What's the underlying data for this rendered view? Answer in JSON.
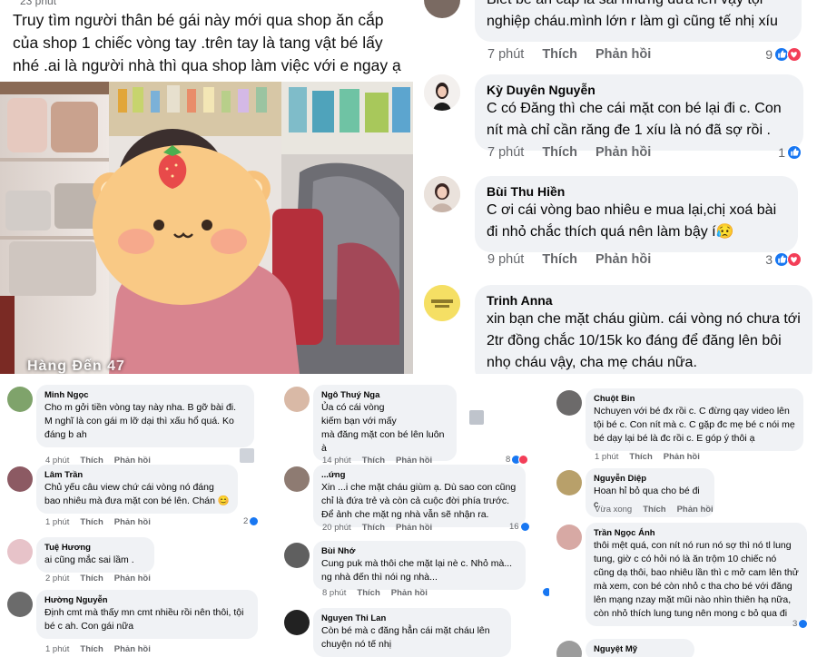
{
  "post": {
    "time": "23 phút",
    "text": "Truy tìm người thân bé gái này mới qua shop ăn cắp của shop 1 chiếc vòng tay .trên tay là tang vật bé lấy nhé .ai là người nhà thì qua shop làm việc với e ngay ạ",
    "photo_caption": "Hàng Đến 47"
  },
  "top_comments": [
    {
      "name": "",
      "text": "Biết bé ăn cắp là sai nhưng đưa lên vậy tội nghiệp cháu.mình lớn r làm gì cũng tế nhị xíu",
      "time": "7 phút",
      "like": "Thích",
      "reply": "Phản hồi",
      "count": "9",
      "reactions": [
        "like",
        "love"
      ]
    },
    {
      "name": "Kỳ Duyên Nguyễn",
      "text": "C có Đăng thì che cái mặt con bé lại đi c. Con nít mà chỉ cần răng đe 1 xíu là nó đã sợ rồi .",
      "time": "7 phút",
      "like": "Thích",
      "reply": "Phản hồi",
      "count": "1",
      "reactions": [
        "like"
      ]
    },
    {
      "name": "Bùi Thu Hiền",
      "text": "C ơi cái vòng bao nhiêu e mua lại,chị xoá bài đi nhỏ chắc thích quá nên làm bậy í😥",
      "time": "9 phút",
      "like": "Thích",
      "reply": "Phản hồi",
      "count": "3",
      "reactions": [
        "like",
        "love"
      ]
    },
    {
      "name": "Trinh Anna",
      "text": "xin  bạn che mặt cháu giùm. cái vòng nó chưa tới 2tr đồng chắc 10/15k ko đáng  để đăng lên bôi nhọ cháu vậy, cha mẹ cháu nữa.\ncon nít ko hiểu biết thích quá cầm thôi chứ gì",
      "time": "",
      "like": "",
      "reply": "",
      "count": "",
      "reactions": []
    }
  ],
  "col1": [
    {
      "name": "Minh Ngọc",
      "text": "Cho m gởi tiền vòng tay này nha. B gỡ bài đi. M nghĩ là con gái m lỡ dại thì xấu hổ quá. Ko đáng b ah",
      "time": "4 phút",
      "like": "Thích",
      "reply": "Phản hồi",
      "count": "",
      "reactions": []
    },
    {
      "name": "Lâm Trần",
      "text": "Chủ yếu câu view chứ cái vòng nó đáng bao nhiêu mà đưa mặt con bé lên. Chán 😊",
      "time": "1 phút",
      "like": "Thích",
      "reply": "Phản hồi",
      "count": "2",
      "reactions": [
        "like"
      ]
    },
    {
      "name": "Tuệ Hương",
      "text": "ai cũng mắc sai lầm .",
      "time": "2 phút",
      "like": "Thích",
      "reply": "Phản hồi",
      "count": "",
      "reactions": []
    },
    {
      "name": "Hường Nguyễn",
      "text": "Định cmt mà thấy mn cmt nhiều rồi nên thôi, tội bé c ah. Con gái nữa",
      "time": "1 phút",
      "like": "Thích",
      "reply": "Phản hồi",
      "count": "",
      "reactions": []
    }
  ],
  "col2": [
    {
      "name": "Ngô Thuý Nga",
      "text": "Ủa có cái vòng\nkiếm bạn với mấy\nmà đăng mặt con bé lên luôn à",
      "time": "14 phút",
      "like": "Thích",
      "reply": "Phản hồi",
      "count": "8",
      "reactions": [
        "like",
        "love"
      ]
    },
    {
      "name": "...ứng",
      "text": "Xin ...i che mặt cháu giùm ạ. Dù sao con cũng chỉ là đứa trẻ và còn cả cuộc đời phía trước. Để ảnh che mặt ng nhà vẫn sẽ nhận ra.",
      "time": "20 phút",
      "like": "Thích",
      "reply": "Phản hồi",
      "count": "16",
      "reactions": [
        "like"
      ]
    },
    {
      "name": "Bùi Nhớ",
      "text": "Cung puk mà thôi che mặt lại nè c. Nhỏ mà... ng nhà đến thì nói ng nhà...",
      "time": "8 phút",
      "like": "Thích",
      "reply": "Phản hồi",
      "count": "",
      "reactions": [
        "like"
      ]
    },
    {
      "name": "Nguyen Thi Lan",
      "text": "Còn bé mà c đăng hẳn cái mặt cháu lên chuyện nó tế nhị",
      "time": "",
      "like": "",
      "reply": "",
      "count": "",
      "reactions": []
    }
  ],
  "col3": [
    {
      "name": "Chuột Bin",
      "text": "Nchuyen với bé đx rồi c. C đừng qay video lên tội bé c. Con nít mà c. C gặp đc mẹ bé c nói mẹ bé dạy lại bé là đc rồi c. E góp ý thôi ạ",
      "time": "1 phút",
      "like": "Thích",
      "reply": "Phản hồi",
      "count": "",
      "reactions": []
    },
    {
      "name": "Nguyễn Diệp",
      "text": "Hoan hỉ bỏ qua cho bé đi c",
      "time": "Vừa xong",
      "like": "Thích",
      "reply": "Phản hồi",
      "count": "",
      "reactions": []
    },
    {
      "name": "Trần Ngọc Ánh",
      "text": "thôi mệt quá, con nít nó run nó sợ thì nó tl lung tung, giờ c có hỏi nó là ăn trộm 10 chiếc nó cũng dạ thôi, bao nhiêu lần thì c mở cam lên thử mà xem, con bé còn nhỏ c tha cho bé với đăng lên mạng nzay mặt mũi nào nhìn thiên hạ nữa, còn nhỏ thích lung tung nên mong c bỏ qua đi",
      "time": "",
      "like": "",
      "reply": "",
      "count": "3",
      "reactions": [
        "like"
      ]
    },
    {
      "name": "Nguyệt Mỹ",
      "text": "",
      "time": "",
      "like": "",
      "reply": "",
      "count": "",
      "reactions": []
    }
  ]
}
